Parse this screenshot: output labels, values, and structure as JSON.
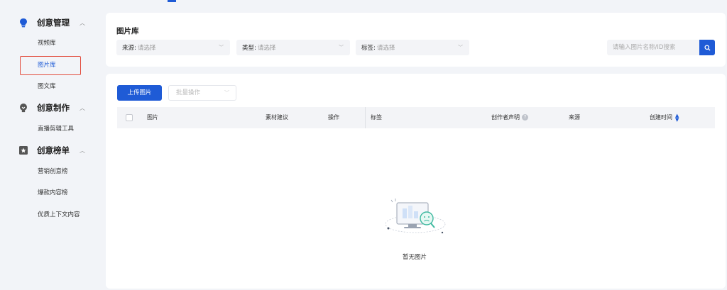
{
  "sidebar": {
    "groups": [
      {
        "label": "创意管理",
        "icon": "bulb-icon",
        "items": [
          "视频库",
          "图片库",
          "图文库"
        ]
      },
      {
        "label": "创意制作",
        "icon": "lightbulb-tool-icon",
        "items": [
          "直播剪辑工具"
        ]
      },
      {
        "label": "创意榜单",
        "icon": "ranking-icon",
        "items": [
          "营销创意榜",
          "爆款内容榜",
          "优质上下文内容"
        ]
      }
    ],
    "active_item": "图片库"
  },
  "header": {
    "title": "图片库"
  },
  "filters": {
    "source": {
      "label": "来源:",
      "value": "请选择"
    },
    "type": {
      "label": "类型:",
      "value": "请选择"
    },
    "tag": {
      "label": "标签:",
      "value": "请选择"
    }
  },
  "search": {
    "placeholder": "请输入图片名称/ID搜索"
  },
  "toolbar": {
    "upload_label": "上传图片",
    "batch_label": "批量操作"
  },
  "table": {
    "columns": [
      "图片",
      "素材建议",
      "操作",
      "标签",
      "创作者声明",
      "来源",
      "创建时间"
    ],
    "rows": []
  },
  "empty_state": {
    "text": "暂无图片"
  },
  "colors": {
    "accent": "#1f5bd6",
    "highlight_border": "#e24a3b"
  }
}
